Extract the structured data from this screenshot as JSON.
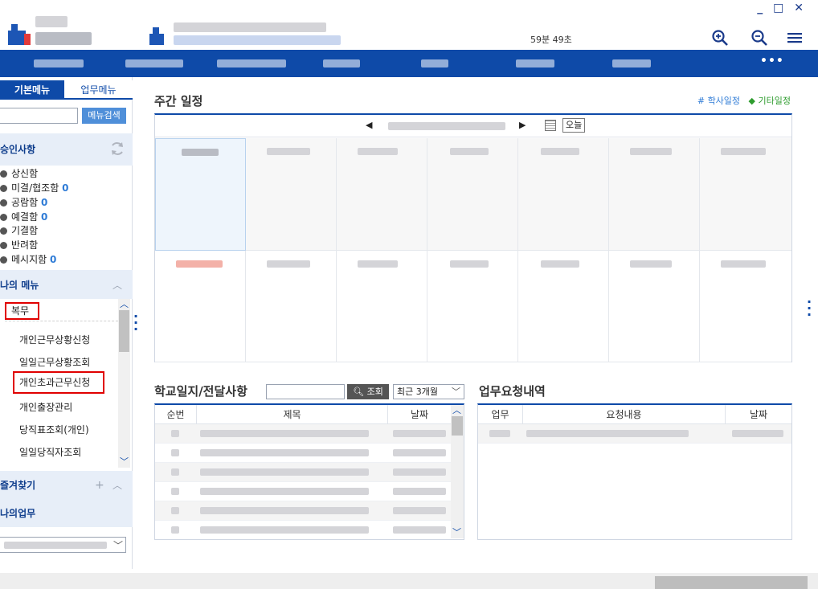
{
  "window_controls": {
    "minimize": "_",
    "maximize": "□",
    "close": "✕"
  },
  "header": {
    "timer": "59분 49초",
    "zoom_in_icon": "zoom-in-icon",
    "zoom_out_icon": "zoom-out-icon",
    "menu_icon": "hamburger-menu-icon",
    "more": "•••"
  },
  "left": {
    "tabs": [
      "기본메뉴",
      "업무메뉴"
    ],
    "menu_search_button": "메뉴검색",
    "approval": {
      "title": "승인사항",
      "items": [
        {
          "label": "상신함",
          "count": ""
        },
        {
          "label": "미결/협조함",
          "count": "0"
        },
        {
          "label": "공람함",
          "count": "0"
        },
        {
          "label": "예결함",
          "count": "0"
        },
        {
          "label": "기결함",
          "count": ""
        },
        {
          "label": "반려함",
          "count": ""
        },
        {
          "label": "메시지함",
          "count": "0"
        }
      ]
    },
    "my_menu": {
      "title": "나의 메뉴",
      "group": "복무",
      "items": [
        "개인근무상황신청",
        "일일근무상황조회",
        "개인초과근무신청",
        "개인출장관리",
        "당직표조회(개인)",
        "일일당직자조회"
      ]
    },
    "favorites": {
      "title": "즐겨찾기",
      "add": "+"
    },
    "my_work": {
      "title": "나의업무"
    }
  },
  "main": {
    "weekly_title": "주간 일정",
    "legend": {
      "academic": "학사일정",
      "other": "기타일정",
      "academic_mark": "#",
      "other_mark": "◆"
    },
    "today_button": "오늘",
    "school": {
      "title": "학교일지/전달사항",
      "search_button": "조회",
      "period_select": "최근 3개월",
      "columns": [
        "순번",
        "제목",
        "날짜"
      ]
    },
    "request": {
      "title": "업무요청내역",
      "columns": [
        "업무",
        "요청내용",
        "날짜"
      ]
    }
  },
  "colors": {
    "brand": "#0e4aa8",
    "accent": "#2e7bd6",
    "highlight": "#e00000"
  }
}
